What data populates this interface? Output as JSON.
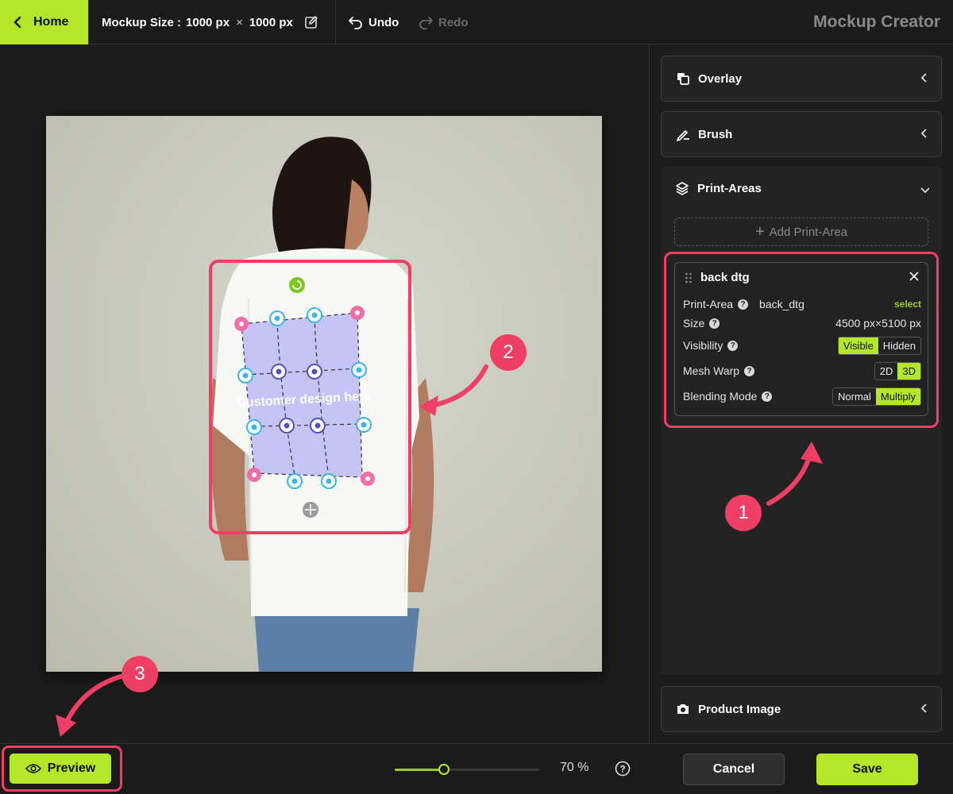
{
  "topbar": {
    "home_label": "Home",
    "mockup_size_label": "Mockup Size :",
    "mockup_width": "1000 px",
    "times": "×",
    "mockup_height": "1000 px",
    "undo_label": "Undo",
    "redo_label": "Redo",
    "app_title": "Mockup Creator"
  },
  "canvas": {
    "design_placeholder": "Customer design here"
  },
  "sidebar": {
    "overlay_label": "Overlay",
    "brush_label": "Brush",
    "print_areas_label": "Print-Areas",
    "add_print_area_label": "Add Print-Area",
    "card": {
      "title": "back dtg",
      "print_area_label": "Print-Area",
      "print_area_value": "back_dtg",
      "select_label": "select",
      "size_label": "Size",
      "size_value": "4500 px×5100 px",
      "visibility_label": "Visibility",
      "visibility_options": [
        "Visible",
        "Hidden"
      ],
      "visibility_selected": "Visible",
      "mesh_warp_label": "Mesh Warp",
      "mesh_warp_options": [
        "2D",
        "3D"
      ],
      "mesh_warp_selected": "3D",
      "blending_label": "Blending Mode",
      "blending_options": [
        "Normal",
        "Multiply"
      ],
      "blending_selected": "Multiply"
    },
    "product_image_label": "Product Image"
  },
  "bottombar": {
    "preview_label": "Preview",
    "zoom_fraction": 0.34,
    "zoom_value": "70 %",
    "cancel_label": "Cancel",
    "save_label": "Save"
  },
  "annotations": [
    "1",
    "2",
    "3"
  ],
  "colors": {
    "accent": "#b4e62a",
    "annotation": "#ef3f64",
    "print_area_fill": "#c3c0f7"
  }
}
